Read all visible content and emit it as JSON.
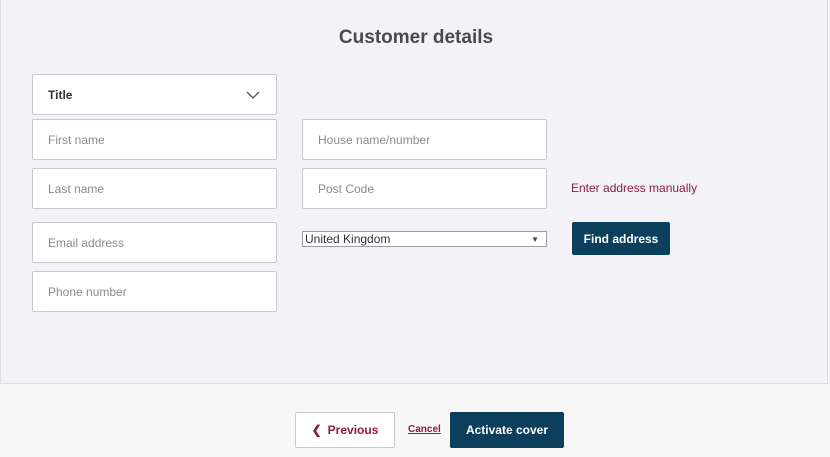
{
  "page": {
    "title": "Customer details"
  },
  "form": {
    "title_select": {
      "value": "Title"
    },
    "first_name": {
      "placeholder": "First name",
      "value": ""
    },
    "last_name": {
      "placeholder": "Last name",
      "value": ""
    },
    "email": {
      "placeholder": "Email address",
      "value": ""
    },
    "phone": {
      "placeholder": "Phone number",
      "value": ""
    },
    "house": {
      "placeholder": "House name/number",
      "value": ""
    },
    "postcode": {
      "placeholder": "Post Code",
      "value": ""
    },
    "country_select": {
      "value": "United Kingdom"
    }
  },
  "actions": {
    "manual_address": "Enter address manually",
    "find_address": "Find address",
    "previous": "Previous",
    "cancel": "Cancel",
    "activate": "Activate cover"
  },
  "icons": {
    "title_chevron": "chevron-down-icon",
    "country_arrow": "triangle-down-icon",
    "previous": "chevron-left-icon"
  },
  "colors": {
    "primary": "#0b3f5c",
    "link": "#8c1c3f",
    "panel_bg": "#f3f3f7",
    "footer_bg": "#f7f7f8"
  }
}
